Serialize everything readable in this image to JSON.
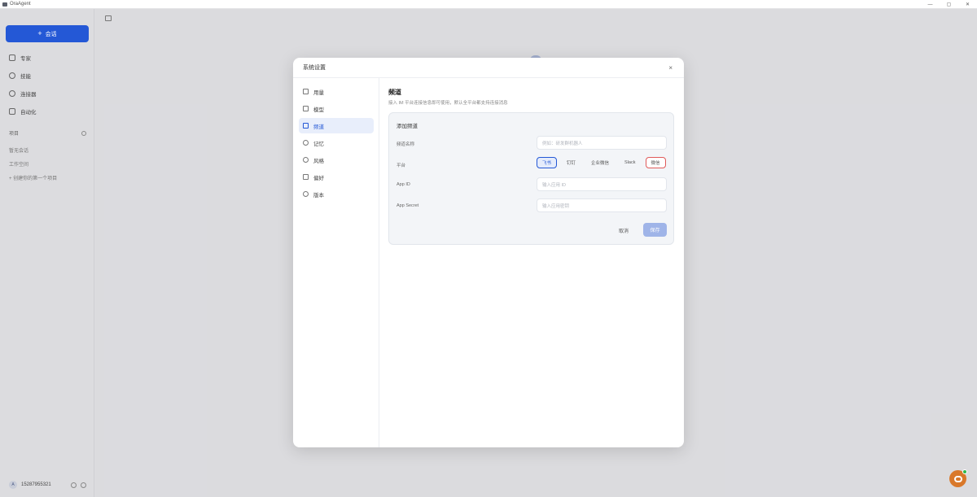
{
  "app": {
    "title": "OraAgent"
  },
  "window_controls": {
    "minimize": "—",
    "maximize": "▢",
    "close": "✕"
  },
  "sidebar": {
    "new_chat": {
      "icon": "plus-icon",
      "label": "会话"
    },
    "nav": [
      {
        "label": "专家",
        "icon": "layers-icon"
      },
      {
        "label": "技能",
        "icon": "puzzle-icon"
      },
      {
        "label": "连接器",
        "icon": "link-icon"
      },
      {
        "label": "自动化",
        "icon": "calendar-icon"
      }
    ],
    "section_title": "项目",
    "projects": [
      "暂无会话",
      "工作空间",
      "+ 创建你的第一个项目"
    ],
    "user": {
      "avatar": "A",
      "name": "15287955321"
    }
  },
  "modal": {
    "title": "系统设置",
    "close": "×",
    "nav": [
      {
        "label": "用量",
        "icon": "bar-chart-icon"
      },
      {
        "label": "模型",
        "icon": "sliders-icon"
      },
      {
        "label": "频道",
        "icon": "channel-icon",
        "active": true
      },
      {
        "label": "记忆",
        "icon": "memory-icon"
      },
      {
        "label": "风格",
        "icon": "heart-icon"
      },
      {
        "label": "偏好",
        "icon": "list-icon"
      },
      {
        "label": "版本",
        "icon": "info-icon"
      }
    ],
    "content": {
      "title": "频道",
      "description": "接入 IM 平台连接信息即可使用，默认全平台都支持连接消息",
      "form": {
        "title": "添加频道",
        "name_label": "频道名称",
        "name_placeholder": "例如：研发群机器人",
        "platform_label": "平台",
        "platforms": [
          {
            "label": "飞书",
            "state": "selected"
          },
          {
            "label": "钉钉",
            "state": ""
          },
          {
            "label": "企业微信",
            "state": ""
          },
          {
            "label": "Slack",
            "state": ""
          },
          {
            "label": "微信",
            "state": "flagged"
          }
        ],
        "app_id_label": "App ID",
        "app_id_placeholder": "输入应用 ID",
        "app_secret_label": "App Secret",
        "app_secret_placeholder": "输入应用密钥",
        "cancel": "取消",
        "save": "保存"
      }
    }
  },
  "colors": {
    "accent": "#2458d6",
    "save_disabled": "#9fb4e8",
    "flag": "#e05a5a",
    "assistant": "#d9782a",
    "online": "#2fb84c"
  }
}
